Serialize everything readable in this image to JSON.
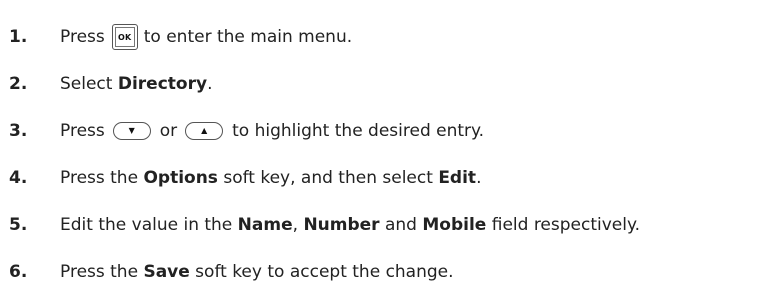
{
  "steps": [
    {
      "number": "1.",
      "before": "Press",
      "ok_key": "OK",
      "after": "to enter the main menu."
    },
    {
      "number": "2.",
      "before": "Select ",
      "bold": "Directory",
      "after": "."
    },
    {
      "number": "3.",
      "before": "Press",
      "down_key": "▼",
      "middle": "or",
      "up_key": "▲",
      "after": "to highlight the desired entry."
    },
    {
      "number": "4.",
      "before": "Press the ",
      "bold1": "Options",
      "middle": " soft key, and then select ",
      "bold2": "Edit",
      "after": "."
    },
    {
      "number": "5.",
      "before": "Edit the value in the ",
      "bold1": "Name",
      "sep1": ", ",
      "bold2": "Number",
      "sep2": " and ",
      "bold3": "Mobile",
      "after": " field respectively."
    },
    {
      "number": "6.",
      "before": "Press the ",
      "bold": "Save",
      "after": " soft key to accept the change."
    }
  ]
}
